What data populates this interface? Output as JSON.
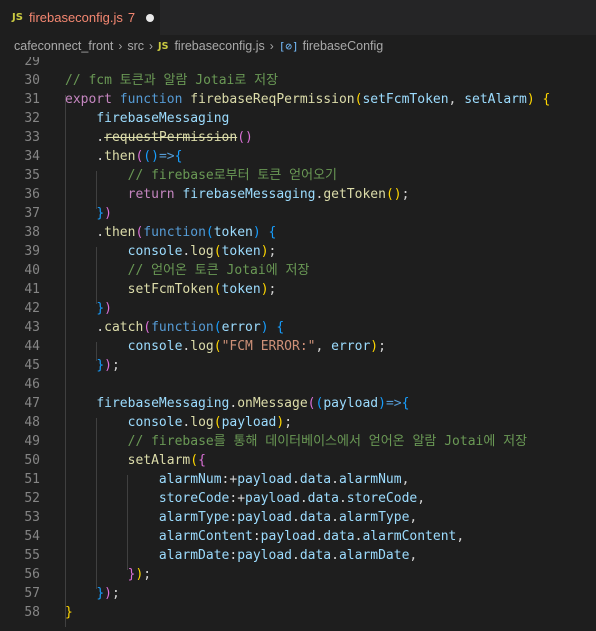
{
  "tab": {
    "badge": "JS",
    "name": "firebaseconfig.js",
    "problems": "7"
  },
  "breadcrumb": {
    "folder1": "cafeconnect_front",
    "folder2": "src",
    "file_badge": "JS",
    "file": "firebaseconfig.js",
    "symbol_icon": "[⊘]",
    "symbol": "firebaseConfig"
  },
  "lines": [
    {
      "n": "29",
      "segs": []
    },
    {
      "n": "30",
      "segs": [
        {
          "t": "// fcm 토큰과 알람 Jotai로 저장",
          "c": "c-comment"
        }
      ]
    },
    {
      "n": "31",
      "segs": [
        {
          "t": "export",
          "c": "c-kw2"
        },
        {
          "t": " "
        },
        {
          "t": "function",
          "c": "c-kw"
        },
        {
          "t": " "
        },
        {
          "t": "firebaseReqPermission",
          "c": "c-fn"
        },
        {
          "t": "(",
          "c": "c-b1"
        },
        {
          "t": "setFcmToken",
          "c": "c-var"
        },
        {
          "t": ", "
        },
        {
          "t": "setAlarm",
          "c": "c-var"
        },
        {
          "t": ")",
          "c": "c-b1"
        },
        {
          "t": " "
        },
        {
          "t": "{",
          "c": "c-b1"
        }
      ]
    },
    {
      "n": "32",
      "segs": [
        {
          "t": "    "
        },
        {
          "t": "firebaseMessaging",
          "c": "c-var"
        }
      ]
    },
    {
      "n": "33",
      "segs": [
        {
          "t": "    ."
        },
        {
          "t": "requestPermission",
          "c": "c-fn",
          "s": true
        },
        {
          "t": "()",
          "c": "c-b2"
        }
      ]
    },
    {
      "n": "34",
      "segs": [
        {
          "t": "    ."
        },
        {
          "t": "then",
          "c": "c-fn"
        },
        {
          "t": "(",
          "c": "c-b2"
        },
        {
          "t": "()",
          "c": "c-b3"
        },
        {
          "t": "=>",
          "c": "c-kw"
        },
        {
          "t": "{",
          "c": "c-b3"
        }
      ]
    },
    {
      "n": "35",
      "segs": [
        {
          "t": "        "
        },
        {
          "t": "// firebase로부터 토큰 얻어오기",
          "c": "c-comment"
        }
      ]
    },
    {
      "n": "36",
      "segs": [
        {
          "t": "        "
        },
        {
          "t": "return",
          "c": "c-kw2"
        },
        {
          "t": " "
        },
        {
          "t": "firebaseMessaging",
          "c": "c-var"
        },
        {
          "t": "."
        },
        {
          "t": "getToken",
          "c": "c-fn"
        },
        {
          "t": "()",
          "c": "c-b1"
        },
        {
          "t": ";"
        }
      ]
    },
    {
      "n": "37",
      "segs": [
        {
          "t": "    "
        },
        {
          "t": "}",
          "c": "c-b3"
        },
        {
          "t": ")",
          "c": "c-b2"
        }
      ]
    },
    {
      "n": "38",
      "segs": [
        {
          "t": "    ."
        },
        {
          "t": "then",
          "c": "c-fn"
        },
        {
          "t": "(",
          "c": "c-b2"
        },
        {
          "t": "function",
          "c": "c-kw"
        },
        {
          "t": "(",
          "c": "c-b3"
        },
        {
          "t": "token",
          "c": "c-var"
        },
        {
          "t": ")",
          "c": "c-b3"
        },
        {
          "t": " "
        },
        {
          "t": "{",
          "c": "c-b3"
        }
      ]
    },
    {
      "n": "39",
      "segs": [
        {
          "t": "        "
        },
        {
          "t": "console",
          "c": "c-var"
        },
        {
          "t": "."
        },
        {
          "t": "log",
          "c": "c-fn"
        },
        {
          "t": "(",
          "c": "c-b1"
        },
        {
          "t": "token",
          "c": "c-var"
        },
        {
          "t": ")",
          "c": "c-b1"
        },
        {
          "t": ";"
        }
      ]
    },
    {
      "n": "40",
      "segs": [
        {
          "t": "        "
        },
        {
          "t": "// 얻어온 토큰 Jotai에 저장",
          "c": "c-comment"
        }
      ]
    },
    {
      "n": "41",
      "segs": [
        {
          "t": "        "
        },
        {
          "t": "setFcmToken",
          "c": "c-fn"
        },
        {
          "t": "(",
          "c": "c-b1"
        },
        {
          "t": "token",
          "c": "c-var"
        },
        {
          "t": ")",
          "c": "c-b1"
        },
        {
          "t": ";"
        }
      ]
    },
    {
      "n": "42",
      "segs": [
        {
          "t": "    "
        },
        {
          "t": "}",
          "c": "c-b3"
        },
        {
          "t": ")",
          "c": "c-b2"
        }
      ]
    },
    {
      "n": "43",
      "segs": [
        {
          "t": "    ."
        },
        {
          "t": "catch",
          "c": "c-fn"
        },
        {
          "t": "(",
          "c": "c-b2"
        },
        {
          "t": "function",
          "c": "c-kw"
        },
        {
          "t": "(",
          "c": "c-b3"
        },
        {
          "t": "error",
          "c": "c-var"
        },
        {
          "t": ")",
          "c": "c-b3"
        },
        {
          "t": " "
        },
        {
          "t": "{",
          "c": "c-b3"
        }
      ]
    },
    {
      "n": "44",
      "segs": [
        {
          "t": "        "
        },
        {
          "t": "console",
          "c": "c-var"
        },
        {
          "t": "."
        },
        {
          "t": "log",
          "c": "c-fn"
        },
        {
          "t": "(",
          "c": "c-b1"
        },
        {
          "t": "\"FCM ERROR:\"",
          "c": "c-str"
        },
        {
          "t": ", "
        },
        {
          "t": "error",
          "c": "c-var"
        },
        {
          "t": ")",
          "c": "c-b1"
        },
        {
          "t": ";"
        }
      ]
    },
    {
      "n": "45",
      "segs": [
        {
          "t": "    "
        },
        {
          "t": "}",
          "c": "c-b3"
        },
        {
          "t": ")",
          "c": "c-b2"
        },
        {
          "t": ";"
        }
      ]
    },
    {
      "n": "46",
      "segs": []
    },
    {
      "n": "47",
      "segs": [
        {
          "t": "    "
        },
        {
          "t": "firebaseMessaging",
          "c": "c-var"
        },
        {
          "t": "."
        },
        {
          "t": "onMessage",
          "c": "c-fn"
        },
        {
          "t": "(",
          "c": "c-b2"
        },
        {
          "t": "(",
          "c": "c-b3"
        },
        {
          "t": "payload",
          "c": "c-var"
        },
        {
          "t": ")",
          "c": "c-b3"
        },
        {
          "t": "=>",
          "c": "c-kw"
        },
        {
          "t": "{",
          "c": "c-b3"
        }
      ]
    },
    {
      "n": "48",
      "segs": [
        {
          "t": "        "
        },
        {
          "t": "console",
          "c": "c-var"
        },
        {
          "t": "."
        },
        {
          "t": "log",
          "c": "c-fn"
        },
        {
          "t": "(",
          "c": "c-b1"
        },
        {
          "t": "payload",
          "c": "c-var"
        },
        {
          "t": ")",
          "c": "c-b1"
        },
        {
          "t": ";"
        }
      ]
    },
    {
      "n": "49",
      "segs": [
        {
          "t": "        "
        },
        {
          "t": "// firebase를 통해 데이터베이스에서 얻어온 알람 Jotai에 저장",
          "c": "c-comment"
        }
      ]
    },
    {
      "n": "50",
      "segs": [
        {
          "t": "        "
        },
        {
          "t": "setAlarm",
          "c": "c-fn"
        },
        {
          "t": "(",
          "c": "c-b1"
        },
        {
          "t": "{",
          "c": "c-b2"
        }
      ]
    },
    {
      "n": "51",
      "segs": [
        {
          "t": "            "
        },
        {
          "t": "alarmNum",
          "c": "c-var"
        },
        {
          "t": ":+"
        },
        {
          "t": "payload",
          "c": "c-var"
        },
        {
          "t": "."
        },
        {
          "t": "data",
          "c": "c-var"
        },
        {
          "t": "."
        },
        {
          "t": "alarmNum",
          "c": "c-var"
        },
        {
          "t": ","
        }
      ]
    },
    {
      "n": "52",
      "segs": [
        {
          "t": "            "
        },
        {
          "t": "storeCode",
          "c": "c-var"
        },
        {
          "t": ":+"
        },
        {
          "t": "payload",
          "c": "c-var"
        },
        {
          "t": "."
        },
        {
          "t": "data",
          "c": "c-var"
        },
        {
          "t": "."
        },
        {
          "t": "storeCode",
          "c": "c-var"
        },
        {
          "t": ","
        }
      ]
    },
    {
      "n": "53",
      "segs": [
        {
          "t": "            "
        },
        {
          "t": "alarmType",
          "c": "c-var"
        },
        {
          "t": ":"
        },
        {
          "t": "payload",
          "c": "c-var"
        },
        {
          "t": "."
        },
        {
          "t": "data",
          "c": "c-var"
        },
        {
          "t": "."
        },
        {
          "t": "alarmType",
          "c": "c-var"
        },
        {
          "t": ","
        }
      ]
    },
    {
      "n": "54",
      "segs": [
        {
          "t": "            "
        },
        {
          "t": "alarmContent",
          "c": "c-var"
        },
        {
          "t": ":"
        },
        {
          "t": "payload",
          "c": "c-var"
        },
        {
          "t": "."
        },
        {
          "t": "data",
          "c": "c-var"
        },
        {
          "t": "."
        },
        {
          "t": "alarmContent",
          "c": "c-var"
        },
        {
          "t": ","
        }
      ]
    },
    {
      "n": "55",
      "segs": [
        {
          "t": "            "
        },
        {
          "t": "alarmDate",
          "c": "c-var"
        },
        {
          "t": ":"
        },
        {
          "t": "payload",
          "c": "c-var"
        },
        {
          "t": "."
        },
        {
          "t": "data",
          "c": "c-var"
        },
        {
          "t": "."
        },
        {
          "t": "alarmDate",
          "c": "c-var"
        },
        {
          "t": ","
        }
      ]
    },
    {
      "n": "56",
      "segs": [
        {
          "t": "        "
        },
        {
          "t": "}",
          "c": "c-b2"
        },
        {
          "t": ")",
          "c": "c-b1"
        },
        {
          "t": ";"
        }
      ]
    },
    {
      "n": "57",
      "segs": [
        {
          "t": "    "
        },
        {
          "t": "}",
          "c": "c-b3"
        },
        {
          "t": ")",
          "c": "c-b2"
        },
        {
          "t": ";"
        }
      ]
    },
    {
      "n": "58",
      "segs": [
        {
          "t": "}",
          "c": "c-b1"
        }
      ]
    }
  ]
}
